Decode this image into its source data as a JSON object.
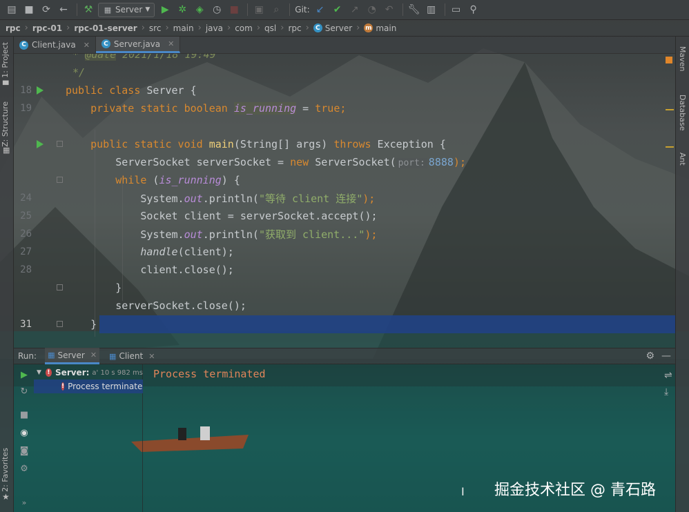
{
  "toolbar": {
    "run_config": "Server",
    "git_label": "Git:",
    "icons": [
      "save-all-icon",
      "save-icon",
      "sync-icon",
      "back-icon",
      "build-hammer-icon",
      "run-icon",
      "debug-icon",
      "coverage-icon",
      "profile-icon",
      "stop-icon",
      "git-update-icon",
      "git-commit-icon",
      "settings-wrench-icon",
      "project-structure-icon",
      "terminal-icon",
      "search-icon"
    ]
  },
  "breadcrumb": {
    "items": [
      "rpc",
      "rpc-01",
      "rpc-01-server",
      "src",
      "main",
      "java",
      "com",
      "qsl",
      "rpc",
      "Server",
      "main"
    ]
  },
  "left_strip": {
    "project": "1: Project",
    "structure": "Z: Structure",
    "favorites": "2: Favorites"
  },
  "right_strip": {
    "maven": "Maven",
    "database": "Database",
    "ant": "Ant"
  },
  "editor": {
    "tabs": [
      {
        "label": "Client.java",
        "active": false
      },
      {
        "label": "Server.java",
        "active": true
      }
    ],
    "line_numbers": [
      "18",
      "19",
      "",
      "",
      "",
      "",
      "24",
      "25",
      "26",
      "27",
      "28",
      "",
      "",
      "31"
    ],
    "visible_numbers": {
      "l18": "18",
      "l19": "19",
      "l24": "24",
      "l25": "25",
      "l26": "26",
      "l27": "27",
      "l28": "28",
      "l31": "31"
    },
    "code": {
      "c1_star": "* ",
      "c1_tag": "@date",
      "c1_rest": " 2021/1/18 19:49",
      "c2": "*/",
      "l18_kw": "public class",
      "l18_rest": " Server {",
      "l19_kw": "private static boolean",
      "l19_field": "is_running",
      "l19_eq": " = ",
      "l19_true": "true",
      "l19_semi": ";",
      "l21_kw1": "public static void",
      "l21_name": "main",
      "l21_args": "(String[] args) ",
      "l21_throws": "throws",
      "l21_exc": " Exception {",
      "l22_a": "ServerSocket serverSocket = ",
      "l22_new": "new",
      "l22_b": " ServerSocket(",
      "l22_hint": "port:",
      "l22_num": "8888",
      "l22_c": ");",
      "l23_while": "while",
      "l23_a": " (",
      "l23_field": "is_running",
      "l23_b": ") {",
      "l24_a": "System.",
      "l24_out": "out",
      "l24_b": ".println(",
      "l24_str": "\"等待 client 连接\"",
      "l24_c": ");",
      "l25_a": "Socket client = serverSocket.accept();",
      "l26_a": "System.",
      "l26_out": "out",
      "l26_b": ".println(",
      "l26_str": "\"获取到 client...\"",
      "l26_c": ");",
      "l27_m": "handle",
      "l27_a": "(client);",
      "l28_a": "client.close();",
      "l29_a": "}",
      "l30_a": "serverSocket.close();",
      "l31_a": "}"
    }
  },
  "run_panel": {
    "title": "Run:",
    "tabs": [
      {
        "label": "Server",
        "active": true
      },
      {
        "label": "Client",
        "active": false
      }
    ],
    "tree": {
      "root_label": "Server:",
      "root_time": "a' 10 s 982 ms",
      "child_label": "Process terminated"
    },
    "console_text": "Process terminated"
  },
  "watermark": "掘金技术社区 @ 青石路",
  "colors": {
    "keyword": "#d9892f",
    "string": "#90ad6a",
    "field": "#b98cd9",
    "selection": "#214283",
    "run_green": "#4fb84f",
    "error_red": "#c94a4a",
    "console_orange": "#e0855a"
  }
}
